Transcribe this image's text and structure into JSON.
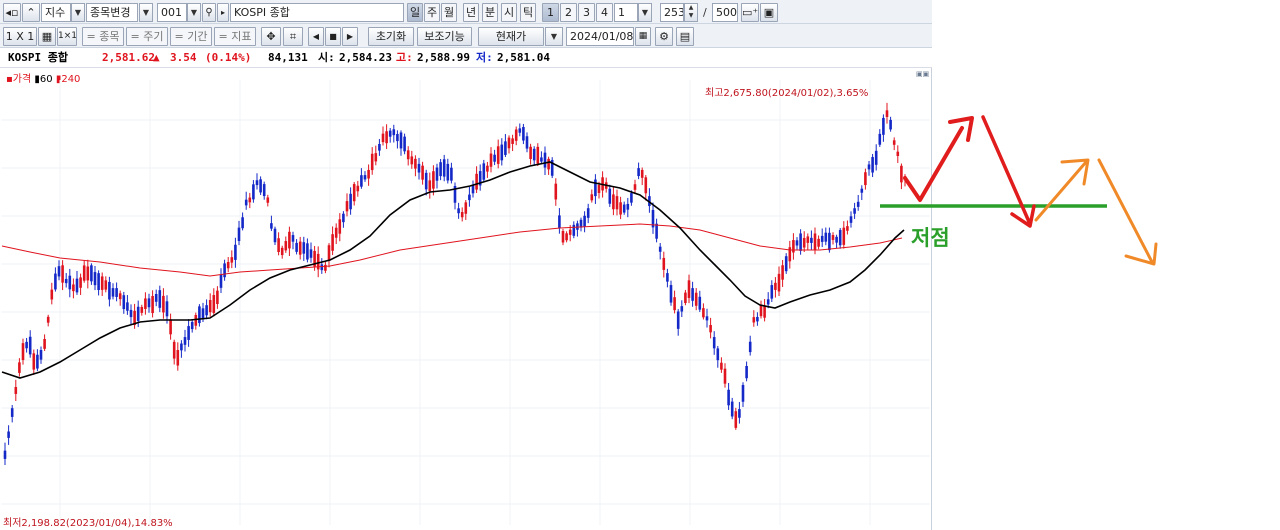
{
  "toolbar1": {
    "category_value": "지수",
    "change_item_label": "종목변경",
    "code_value": "001",
    "name_value": "KOSPI 종합",
    "periods": [
      "일",
      "주",
      "월",
      "년",
      "분",
      "시",
      "틱"
    ],
    "selected_period": "일",
    "numbers": [
      "1",
      "2",
      "3",
      "4"
    ],
    "multiplier_value": "1",
    "count_value": "253",
    "slash": "/",
    "total_value": "500"
  },
  "toolbar2": {
    "grid_label": "1 X 1",
    "item_label": "= 종목",
    "cycle_label": "= 주기",
    "period_label": "= 기간",
    "indicator_label": "= 지표",
    "reset_label": "초기화",
    "aux_label": "보조기능",
    "price_mode_value": "현재가",
    "date_value": "2024/01/08"
  },
  "infobar": {
    "name": "KOSPI 종합",
    "price": "2,581.62",
    "change_arrow": "▲",
    "change": "3.54",
    "change_pct": "(0.14%)",
    "volume": "84,131",
    "open_label": "시:",
    "open_value": "2,584.23",
    "high_label": "고:",
    "high_value": "2,588.99",
    "low_label": "저:",
    "low_value": "2,581.04"
  },
  "legend": {
    "price_label": "가격",
    "ma1_label": "60",
    "ma2_label": "240"
  },
  "annotations": {
    "high_label": "최고2,675.80(2024/01/02),3.65%",
    "low_label": "최저2,198.82(2023/01/04),14.83%",
    "support_label": "저점"
  },
  "colors": {
    "up": "#e0141e",
    "down": "#1428c8",
    "ma60": "#000000",
    "ma240": "#e0141e",
    "drawn_red": "#e11c1c",
    "drawn_orange": "#f08a28",
    "drawn_green": "#2aa02a"
  },
  "chart_data": {
    "type": "candlestick",
    "title": "KOSPI 종합",
    "x_range": [
      "2023/01/04",
      "2024/01/08"
    ],
    "high": {
      "value": 2675.8,
      "date": "2024/01/02",
      "pct": 3.65
    },
    "low": {
      "value": 2198.82,
      "date": "2023/01/04",
      "pct": 14.83
    },
    "last": {
      "open": 2584.23,
      "high": 2588.99,
      "low": 2581.04,
      "close": 2581.62
    },
    "series": [
      {
        "name": "60",
        "type": "moving_average"
      },
      {
        "name": "240",
        "type": "moving_average"
      }
    ]
  }
}
